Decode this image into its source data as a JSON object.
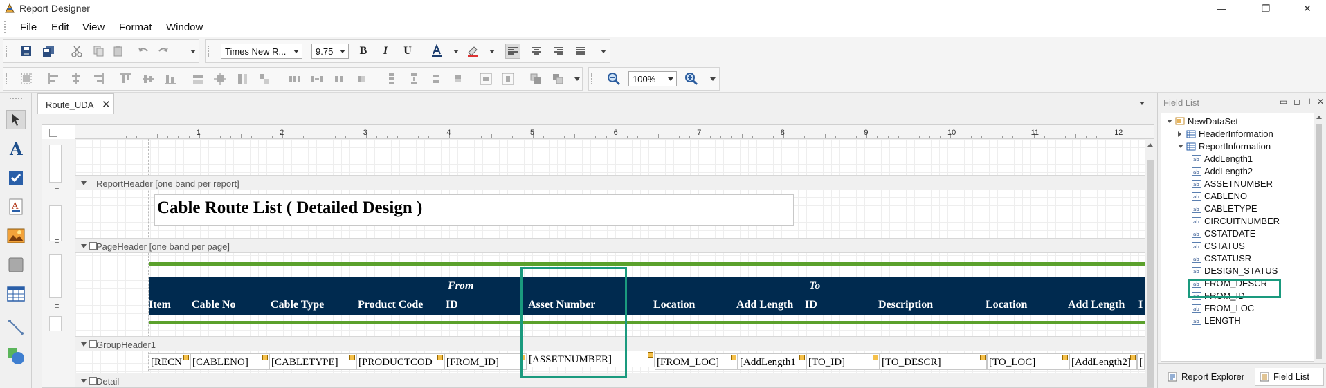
{
  "window": {
    "title": "Report Designer",
    "minimize": "—",
    "restore": "❐",
    "close": "✕"
  },
  "menu": {
    "items": [
      "File",
      "Edit",
      "View",
      "Format",
      "Window"
    ]
  },
  "toolbar": {
    "font_name": "Times New R...",
    "font_size": "9.75",
    "zoom": "100%",
    "bold_label": "B",
    "italic_label": "I",
    "underline_label": "U"
  },
  "document_tab": {
    "label": "Route_UDA",
    "close": "✕"
  },
  "ruler": {
    "numbers": [
      "1",
      "2",
      "3",
      "4",
      "5",
      "6",
      "7",
      "8",
      "9",
      "10",
      "11",
      "12"
    ]
  },
  "bands": {
    "report_header": "ReportHeader [one band per report]",
    "page_header": "PageHeader [one band per page]",
    "group_header": "GroupHeader1",
    "detail": "Detail"
  },
  "report": {
    "title": "Cable Route List ( Detailed Design )",
    "group_from": "From",
    "group_to": "To",
    "columns": [
      "Item",
      "Cable No",
      "Cable Type",
      "Product Code",
      "ID",
      "Asset Number",
      "Location",
      "Add Length",
      "ID",
      "Description",
      "Location",
      "Add Length",
      "I"
    ],
    "fields": [
      "[RECN",
      "[CABLENO]",
      "[CABLETYPE]",
      "[PRODUCTCOD",
      "[FROM_ID]",
      "[ASSETNUMBER]",
      "[FROM_LOC]",
      "[AddLength1",
      "[TO_ID]",
      "[TO_DESCR]",
      "[TO_LOC]",
      "[AddLength2]",
      "["
    ]
  },
  "field_list": {
    "title": "Field List",
    "dataset": "NewDataSet",
    "tables": [
      "HeaderInformation",
      "ReportInformation"
    ],
    "fields": [
      "AddLength1",
      "AddLength2",
      "ASSETNUMBER",
      "CABLENO",
      "CABLETYPE",
      "CIRCUITNUMBER",
      "CSTATDATE",
      "CSTATUS",
      "CSTATUSR",
      "DESIGN_STATUS",
      "FROM_DESCR",
      "FROM_ID",
      "FROM_LOC",
      "LENGTH"
    ],
    "highlighted_field": "ASSETNUMBER",
    "bottom_tabs": [
      "Report Explorer",
      "Field List"
    ]
  },
  "colors": {
    "header_bar": "#002a4f",
    "accent_line": "#5ba12c",
    "highlight": "#1a9a7e"
  }
}
